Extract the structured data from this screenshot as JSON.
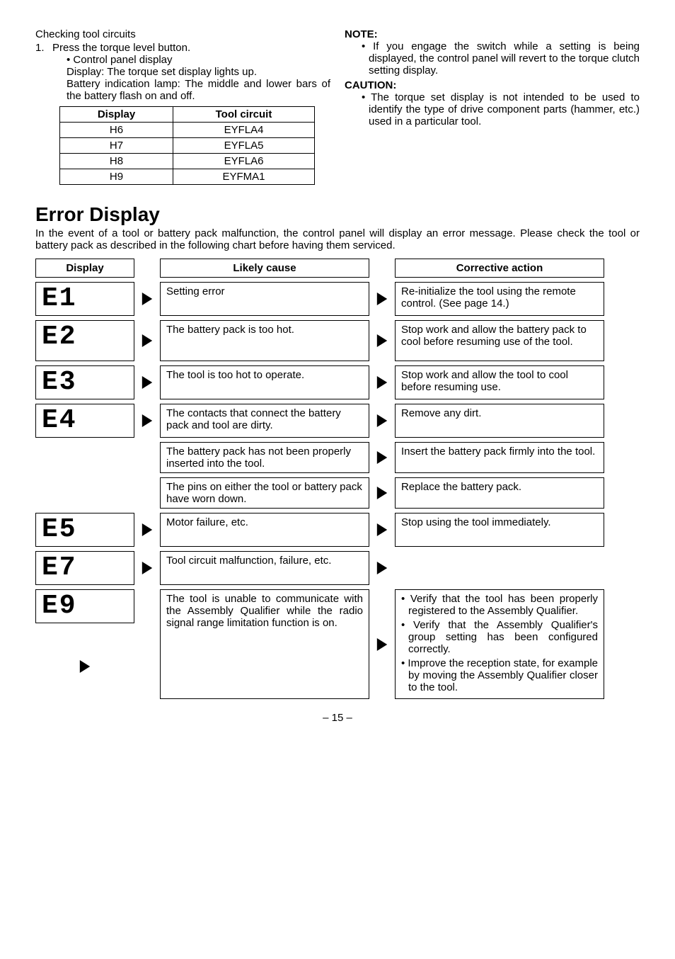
{
  "top": {
    "lead": "Checking tool circuits",
    "step_num": "1.",
    "step_text": "Press the torque level button.",
    "bullet": "• Control panel display",
    "para1": "Display: The torque set display lights up.",
    "para2": "Battery indication lamp: The middle and lower bars of the battery flash on and off.",
    "table": {
      "h1": "Display",
      "h2": "Tool circuit",
      "rows": [
        {
          "d": "H6",
          "t": "EYFLA4"
        },
        {
          "d": "H7",
          "t": "EYFLA5"
        },
        {
          "d": "H8",
          "t": "EYFLA6"
        },
        {
          "d": "H9",
          "t": "EYFMA1"
        }
      ]
    }
  },
  "right": {
    "note_head": "NOTE:",
    "note_bullet": "• If you engage the switch while a setting is being displayed, the control panel will revert to the torque clutch setting display.",
    "caution_head": "CAUTION:",
    "caution_bullet": "• The torque set display is not intended to be used to identify the type of drive component parts (hammer, etc.) used in a particular tool."
  },
  "error": {
    "heading": "Error Display",
    "intro": "In the event of a tool or battery pack malfunction, the control panel will display an error message. Please check the tool or battery pack as described in the following chart before having them serviced.",
    "headers": {
      "display": "Display",
      "cause": "Likely cause",
      "action": "Corrective action"
    },
    "e1": {
      "seg": "E1",
      "cause": "Setting error",
      "action": "Re-initialize the tool using the remote control. (See page 14.)"
    },
    "e2": {
      "seg": "E2",
      "cause": "The battery pack is too hot.",
      "action": "Stop work and allow the battery pack to cool before resuming use of the tool."
    },
    "e3": {
      "seg": "E3",
      "cause": "The tool is too hot to operate.",
      "action": "Stop work and allow the tool to cool before resuming use."
    },
    "e4": {
      "seg": "E4",
      "causes": [
        "The contacts that connect the battery pack and tool are dirty.",
        "The battery pack has not been properly inserted into the tool.",
        "The pins on either the tool or battery pack have worn down."
      ],
      "actions": [
        "Remove any dirt.",
        "Insert the battery pack firmly into the tool.",
        "Replace the battery pack."
      ]
    },
    "e5": {
      "seg": "E5",
      "cause": "Motor failure, etc.",
      "action": "Stop using the tool immediately."
    },
    "e7": {
      "seg": "E7",
      "cause": "Tool circuit malfunction, failure, etc."
    },
    "e9": {
      "seg": "E9",
      "cause": "The tool is unable to communicate with the Assembly Qualifier while the radio signal range limitation function is on.",
      "actions": [
        "• Verify that the tool has been properly registered to the Assembly Qualifier.",
        "• Verify that the Assembly Qualifier's group setting has been configured correctly.",
        "• Improve the reception state, for example by moving the Assembly Qualifier closer to the tool."
      ]
    }
  },
  "page_num": "– 15 –"
}
